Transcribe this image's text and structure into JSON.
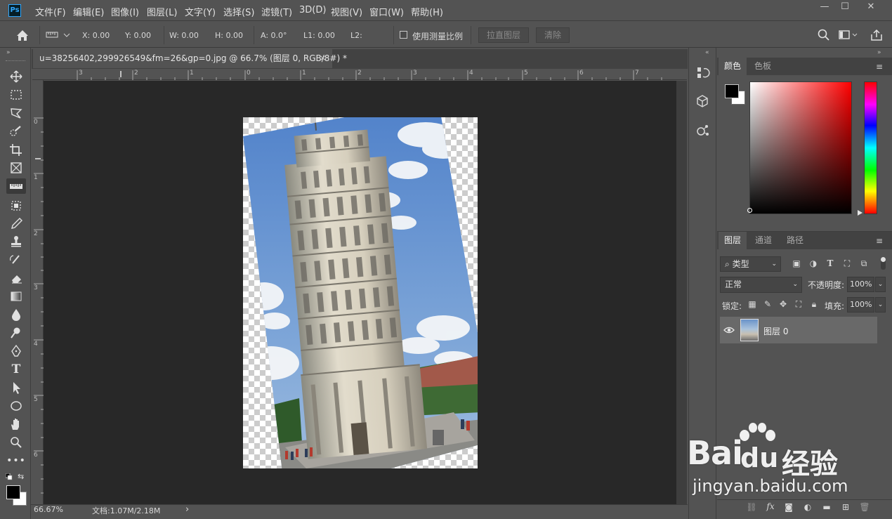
{
  "app": {
    "logo": "Ps",
    "menus": [
      "文件(F)",
      "编辑(E)",
      "图像(I)",
      "图层(L)",
      "文字(Y)",
      "选择(S)",
      "滤镜(T)",
      "3D(D)",
      "视图(V)",
      "窗口(W)",
      "帮助(H)"
    ],
    "window_controls": {
      "minimize": "—",
      "maximize": "☐",
      "close": "✕"
    }
  },
  "options_bar": {
    "x": "X: 0.00",
    "y": "Y: 0.00",
    "w": "W: 0.00",
    "h": "H: 0.00",
    "a": "A: 0.0°",
    "l1": "L1: 0.00",
    "l2": "L2:",
    "use_scale_label": "使用测量比例",
    "straighten_layer": "拉直图层",
    "clear": "清除"
  },
  "document": {
    "tab_title": "u=38256402,299926549&fm=26&gp=0.jpg @ 66.7% (图层 0, RGB/8#) *",
    "close": "×",
    "ruler_top": [
      "3",
      "2",
      "1",
      "0",
      "1",
      "2",
      "3",
      "4",
      "5",
      "6",
      "7"
    ],
    "ruler_left": [
      "0",
      "1",
      "2",
      "3",
      "4",
      "5",
      "6"
    ]
  },
  "status": {
    "zoom": "66.67%",
    "doc": "文档:1.07M/2.18M",
    "arrow": "›"
  },
  "color_panel": {
    "tabs": [
      "颜色",
      "色板"
    ],
    "foreground": "#000000",
    "background": "#ffffff"
  },
  "layers_panel": {
    "tabs": [
      "图层",
      "通道",
      "路径"
    ],
    "filter_kind": "类型",
    "blend_mode": "正常",
    "opacity_label": "不透明度:",
    "opacity": "100%",
    "lock_label": "锁定:",
    "fill_label": "填充:",
    "fill": "100%",
    "layers": [
      {
        "name": "图层 0",
        "visible": true
      }
    ]
  },
  "watermark": {
    "brand": "Bai",
    "brand2": "du",
    "cn": "经验",
    "url": "jingyan.baidu.com"
  },
  "colors": {
    "ui_bg": "#535353",
    "canvas_bg": "#282828",
    "accent": "#31a8ff"
  }
}
